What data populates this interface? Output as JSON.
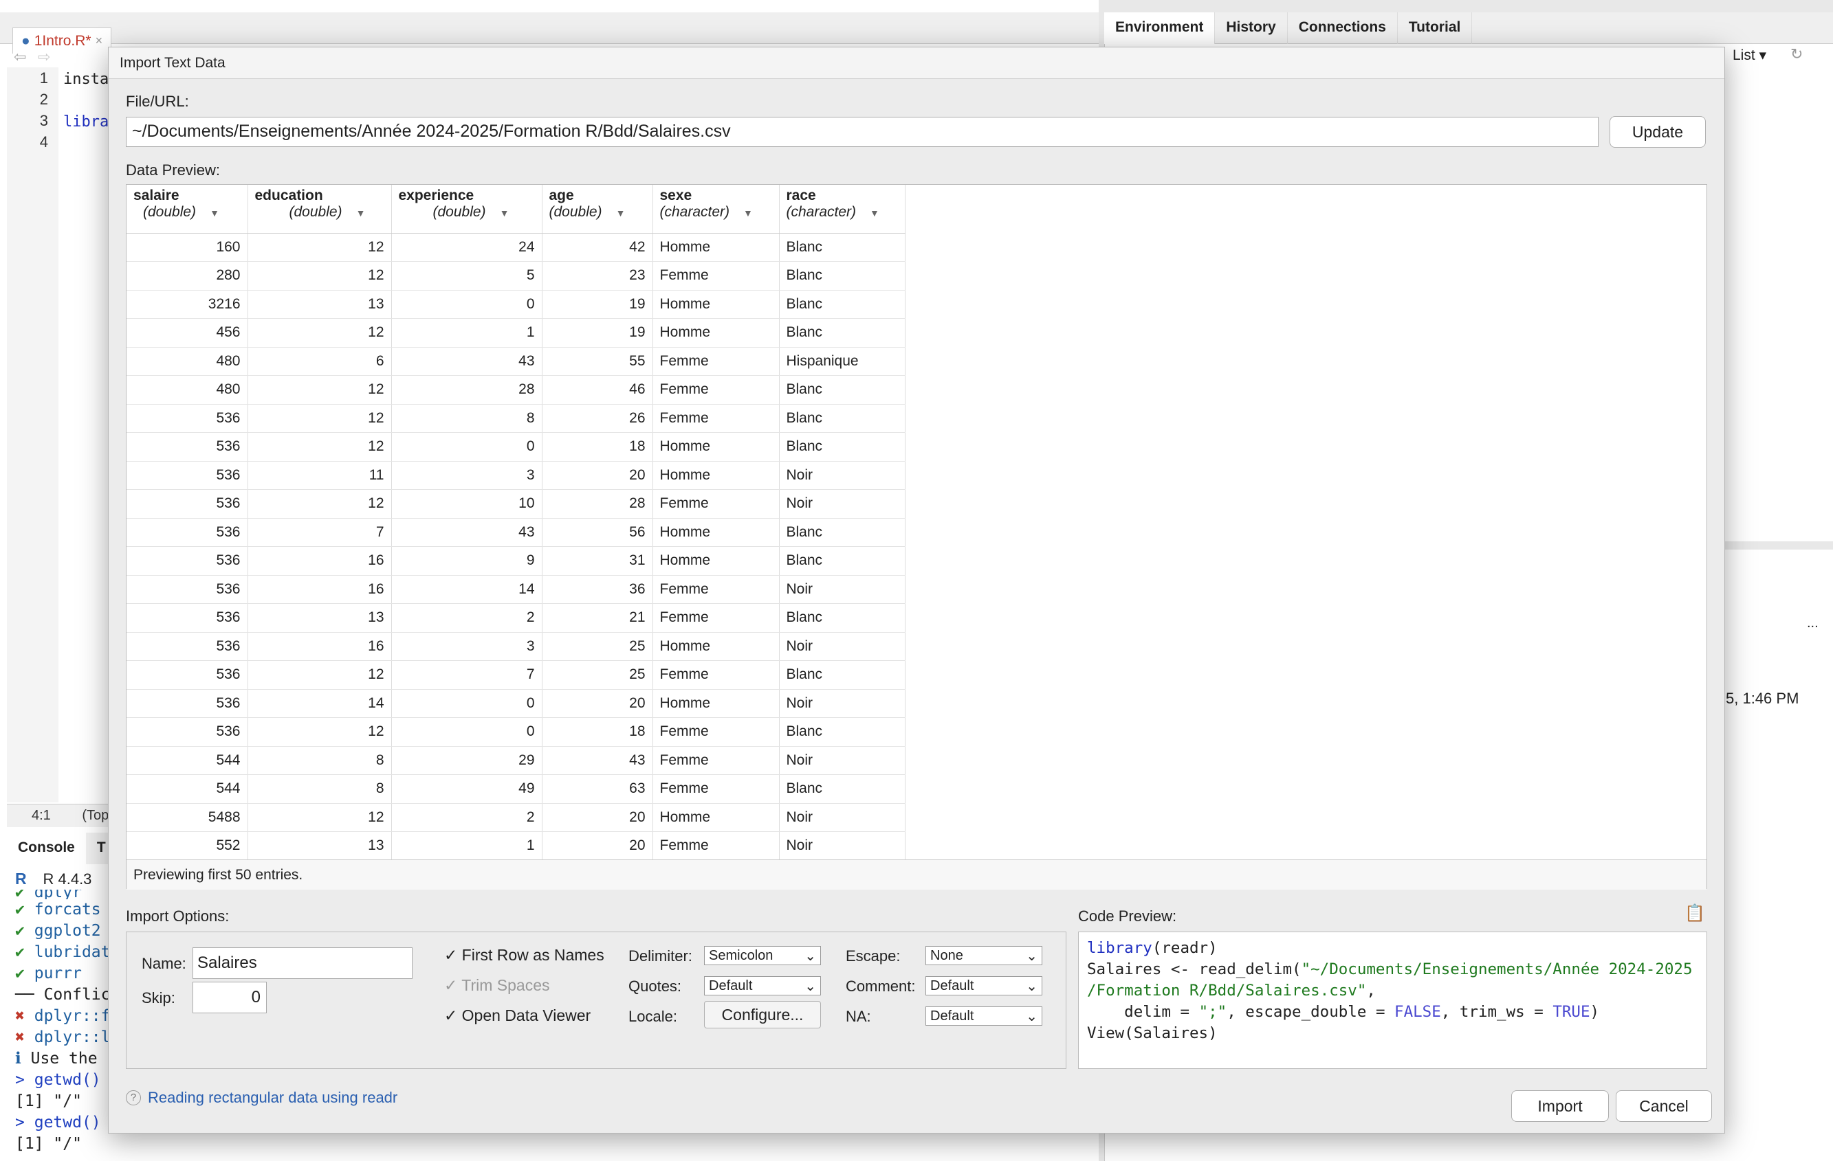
{
  "ide": {
    "file_tab": "1Intro.R*",
    "line_numbers": [
      "1",
      "2",
      "3",
      "4"
    ],
    "code_lines": [
      "insta",
      "",
      "libra",
      ""
    ],
    "cursor_pos": "4:1",
    "status_scope": "(Top",
    "console_tab": "Console",
    "console_tab2": "T",
    "r_version": "R 4.4.3",
    "console_lines": [
      {
        "mark": "✔",
        "text": "dplyr"
      },
      {
        "mark": "✔",
        "text": "forcats"
      },
      {
        "mark": "✔",
        "text": "ggplot2"
      },
      {
        "mark": "✔",
        "text": "lubridate"
      },
      {
        "mark": "✔",
        "text": "purrr"
      },
      {
        "mark": "──",
        "text": "Conflict"
      },
      {
        "mark": "✖",
        "text": "dplyr::f"
      },
      {
        "mark": "✖",
        "text": "dplyr::l"
      },
      {
        "mark": "ℹ",
        "text": "Use the"
      },
      {
        "mark": ">",
        "text": "getwd()"
      },
      {
        "mark": "",
        "text": "[1] \"/\""
      },
      {
        "mark": ">",
        "text": "getwd()"
      },
      {
        "mark": "",
        "text": "[1] \"/\""
      }
    ],
    "right_tabs": [
      "Environment",
      "History",
      "Connections",
      "Tutorial"
    ],
    "list_label": "List",
    "timestamp_fragment": "5, 1:46 PM",
    "ellipsis": "..."
  },
  "dialog": {
    "title": "Import Text Data",
    "file_url_label": "File/URL:",
    "file_url_value": "~/Documents/Enseignements/Année 2024-2025/Formation R/Bdd/Salaires.csv",
    "update_button": "Update",
    "data_preview_label": "Data Preview:",
    "columns": [
      {
        "name": "salaire",
        "type": "(double)"
      },
      {
        "name": "education",
        "type": "(double)"
      },
      {
        "name": "experience",
        "type": "(double)"
      },
      {
        "name": "age",
        "type": "(double)"
      },
      {
        "name": "sexe",
        "type": "(character)"
      },
      {
        "name": "race",
        "type": "(character)"
      }
    ],
    "rows": [
      [
        "160",
        "12",
        "24",
        "42",
        "Homme",
        "Blanc"
      ],
      [
        "280",
        "12",
        "5",
        "23",
        "Femme",
        "Blanc"
      ],
      [
        "3216",
        "13",
        "0",
        "19",
        "Homme",
        "Blanc"
      ],
      [
        "456",
        "12",
        "1",
        "19",
        "Homme",
        "Blanc"
      ],
      [
        "480",
        "6",
        "43",
        "55",
        "Femme",
        "Hispanique"
      ],
      [
        "480",
        "12",
        "28",
        "46",
        "Femme",
        "Blanc"
      ],
      [
        "536",
        "12",
        "8",
        "26",
        "Femme",
        "Blanc"
      ],
      [
        "536",
        "12",
        "0",
        "18",
        "Homme",
        "Blanc"
      ],
      [
        "536",
        "11",
        "3",
        "20",
        "Homme",
        "Noir"
      ],
      [
        "536",
        "12",
        "10",
        "28",
        "Femme",
        "Noir"
      ],
      [
        "536",
        "7",
        "43",
        "56",
        "Homme",
        "Blanc"
      ],
      [
        "536",
        "16",
        "9",
        "31",
        "Homme",
        "Blanc"
      ],
      [
        "536",
        "16",
        "14",
        "36",
        "Femme",
        "Noir"
      ],
      [
        "536",
        "13",
        "2",
        "21",
        "Femme",
        "Blanc"
      ],
      [
        "536",
        "16",
        "3",
        "25",
        "Homme",
        "Noir"
      ],
      [
        "536",
        "12",
        "7",
        "25",
        "Femme",
        "Blanc"
      ],
      [
        "536",
        "14",
        "0",
        "20",
        "Homme",
        "Noir"
      ],
      [
        "536",
        "12",
        "0",
        "18",
        "Femme",
        "Blanc"
      ],
      [
        "544",
        "8",
        "29",
        "43",
        "Femme",
        "Noir"
      ],
      [
        "544",
        "8",
        "49",
        "63",
        "Femme",
        "Blanc"
      ],
      [
        "5488",
        "12",
        "2",
        "20",
        "Homme",
        "Noir"
      ],
      [
        "552",
        "13",
        "1",
        "20",
        "Femme",
        "Noir"
      ]
    ],
    "preview_footer": "Previewing first 50 entries.",
    "import_options_label": "Import Options:",
    "name_label": "Name:",
    "name_value": "Salaires",
    "skip_label": "Skip:",
    "skip_value": "0",
    "first_row_names": "First Row as Names",
    "trim_spaces": "Trim Spaces",
    "open_viewer": "Open Data Viewer",
    "delimiter_label": "Delimiter:",
    "delimiter_value": "Semicolon",
    "quotes_label": "Quotes:",
    "quotes_value": "Default",
    "locale_label": "Locale:",
    "configure_button": "Configure...",
    "escape_label": "Escape:",
    "escape_value": "None",
    "comment_label": "Comment:",
    "comment_value": "Default",
    "na_label": "NA:",
    "na_value": "Default",
    "code_preview_label": "Code Preview:",
    "code": {
      "l1_kw": "library",
      "l1_rest": "(readr)",
      "l2_a": "Salaires <- read_delim(",
      "l2_str": "\"~/Documents/Enseignements/Année 2024-2025",
      "l3_str": "/Formation R/Bdd/Salaires.csv\"",
      "l3_rest": ",",
      "l4_a": "    delim = ",
      "l4_str": "\";\"",
      "l4_b": ", escape_double = ",
      "l4_false": "FALSE",
      "l4_c": ", trim_ws = ",
      "l4_true": "TRUE",
      "l4_d": ")",
      "l5": "View(Salaires)"
    },
    "help_link": "Reading rectangular data using readr",
    "import_button": "Import",
    "cancel_button": "Cancel"
  }
}
